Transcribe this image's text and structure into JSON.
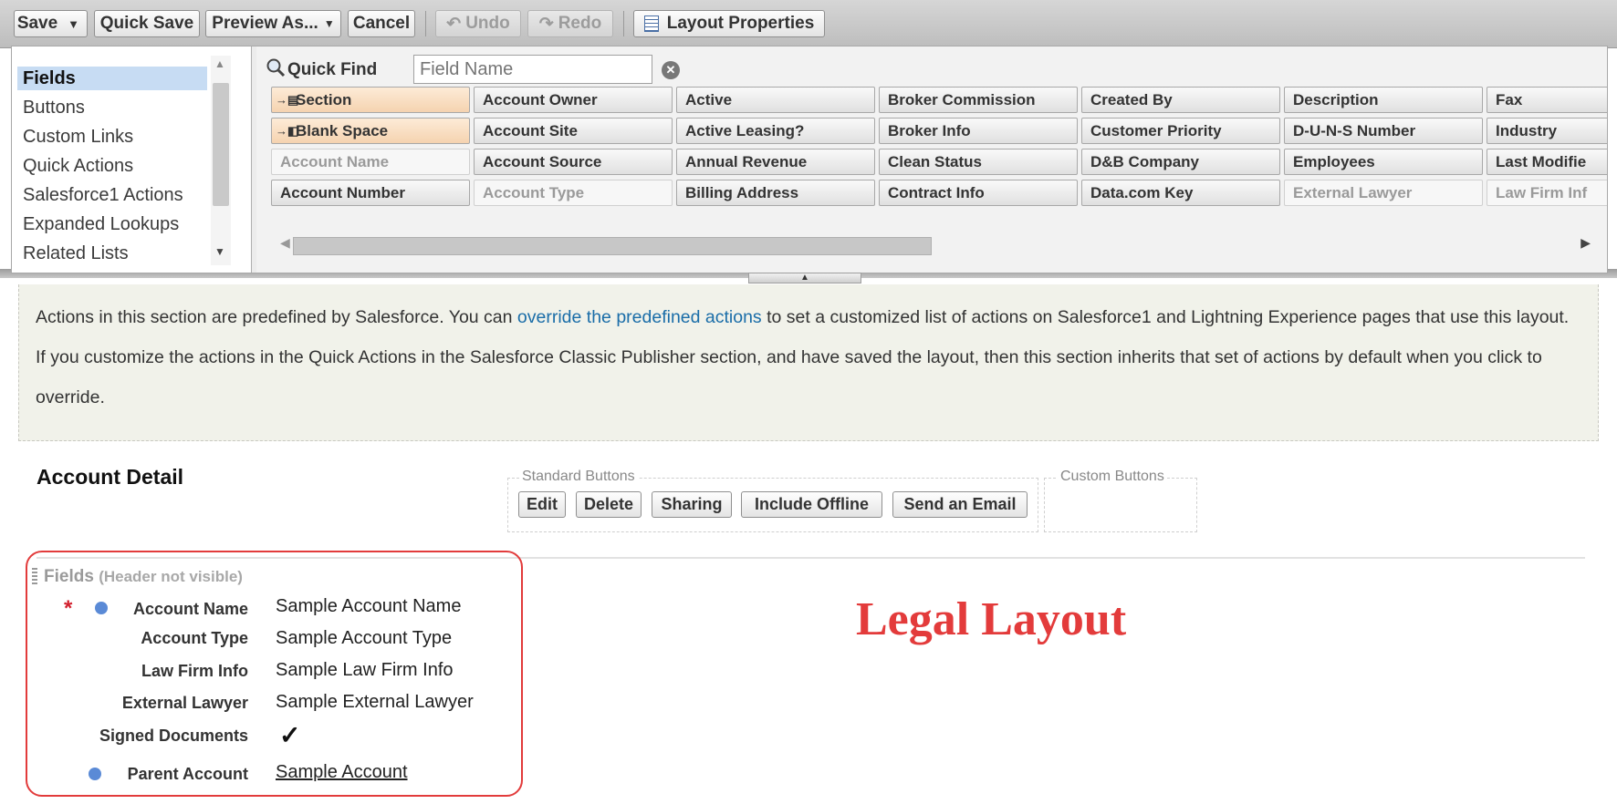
{
  "toolbar": {
    "save": "Save",
    "quick_save": "Quick Save",
    "preview_as": "Preview As...",
    "cancel": "Cancel",
    "undo": "Undo",
    "redo": "Redo",
    "layout_properties": "Layout Properties"
  },
  "palette": {
    "categories": [
      "Fields",
      "Buttons",
      "Custom Links",
      "Quick Actions",
      "Salesforce1 Actions",
      "Expanded Lookups",
      "Related Lists"
    ],
    "selected_category": "Fields",
    "quick_find_label": "Quick Find",
    "quick_find_placeholder": "Field Name",
    "fields": [
      [
        "Section",
        "Account Owner",
        "Active",
        "Broker Commission",
        "Created By",
        "Description",
        "Fax"
      ],
      [
        "Blank Space",
        "Account Site",
        "Active Leasing?",
        "Broker Info",
        "Customer Priority",
        "D-U-N-S Number",
        "Industry"
      ],
      [
        "Account Name",
        "Account Source",
        "Annual Revenue",
        "Clean Status",
        "D&B Company",
        "Employees",
        "Last Modifie"
      ],
      [
        "Account Number",
        "Account Type",
        "Billing Address",
        "Contract Info",
        "Data.com Key",
        "External Lawyer",
        "Law Firm Inf"
      ]
    ]
  },
  "info": {
    "text_before": "Actions in this section are predefined by Salesforce. You can ",
    "link": "override the predefined actions",
    "text_after": " to set a customized list of actions on Salesforce1 and Lightning Experience pages that use this layout. If you customize the actions in the Quick Actions in the Salesforce Classic Publisher section, and have saved the layout, then this section inherits that set of actions by default when you click to override."
  },
  "detail": {
    "title": "Account Detail",
    "standard_buttons_label": "Standard Buttons",
    "custom_buttons_label": "Custom Buttons",
    "buttons": [
      "Edit",
      "Delete",
      "Sharing",
      "Include Offline",
      "Send an Email"
    ],
    "fields_header": "Fields",
    "fields_header_note": "(Header not visible)",
    "fields": [
      {
        "label": "Account Name",
        "value": "Sample Account Name"
      },
      {
        "label": "Account Type",
        "value": "Sample Account Type"
      },
      {
        "label": "Law Firm Info",
        "value": "Sample Law Firm Info"
      },
      {
        "label": "External Lawyer",
        "value": "Sample External Lawyer"
      },
      {
        "label": "Signed Documents",
        "value": "✓"
      },
      {
        "label": "Parent Account",
        "value": "Sample Account"
      }
    ]
  },
  "overlay_text": "Legal Layout",
  "colors": {
    "accent_red": "#e33b3b",
    "link_blue": "#1a6da8",
    "selected_bg": "#c7dcf3"
  }
}
